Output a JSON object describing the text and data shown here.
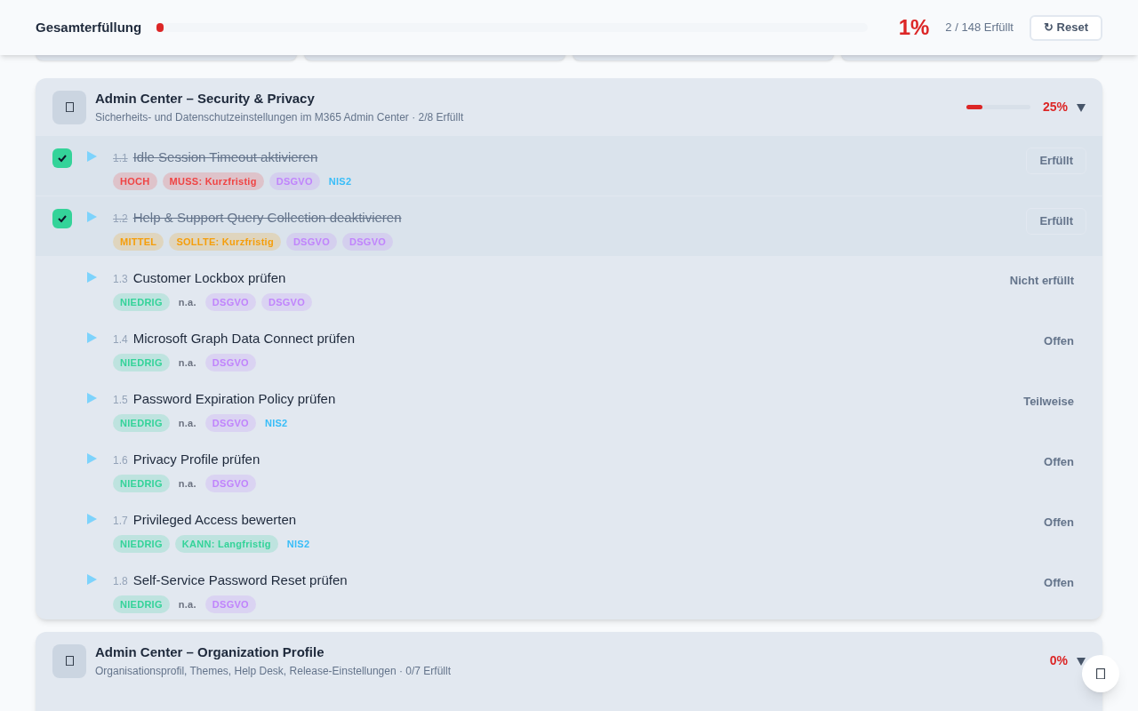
{
  "header": {
    "title": "Gesamterfüllung",
    "level": 0.01,
    "percent": "1%",
    "count": "2 / 148 Erfüllt",
    "reset_button": "↻ Reset"
  },
  "sections": [
    {
      "title": "Admin Center – Security & Privacy",
      "subtitle": "Sicherheits- und Datenschutzeinstellungen im M365 Admin Center · 2/8 Erfüllt",
      "level": 0.25,
      "percent": "25%",
      "expanded": true,
      "items": [
        {
          "number": "1.1",
          "title": "Idle Session Timeout aktivieren",
          "checked": true,
          "status": "Erfüllt",
          "tags": [
            {
              "text": "HOCH",
              "kind": "pill",
              "color": "#ef4444"
            },
            {
              "text": "MUSS: Kurzfristig",
              "kind": "pill",
              "color": "#ef4444"
            },
            {
              "text": "DSGVO",
              "kind": "pill",
              "color": "#c084fc"
            },
            {
              "text": "NIS2",
              "kind": "plain",
              "color": "#38bdf8"
            }
          ]
        },
        {
          "number": "1.2",
          "title": "Help & Support Query Collection deaktivieren",
          "checked": true,
          "status": "Erfüllt",
          "tags": [
            {
              "text": "MITTEL",
              "kind": "pill",
              "color": "#f59e0b"
            },
            {
              "text": "SOLLTE: Kurzfristig",
              "kind": "pill",
              "color": "#f59e0b"
            },
            {
              "text": "DSGVO",
              "kind": "pill",
              "color": "#c084fc"
            },
            {
              "text": "DSGVO",
              "kind": "pill",
              "color": "#c084fc"
            }
          ]
        },
        {
          "number": "1.3",
          "title": "Customer Lockbox prüfen",
          "checked": false,
          "status": "Nicht erfüllt",
          "tags": [
            {
              "text": "NIEDRIG",
              "kind": "pill",
              "color": "#34d399"
            },
            {
              "text": "n.a.",
              "kind": "plain",
              "color": "#6b7280"
            },
            {
              "text": "DSGVO",
              "kind": "pill",
              "color": "#c084fc"
            },
            {
              "text": "DSGVO",
              "kind": "pill",
              "color": "#c084fc"
            }
          ]
        },
        {
          "number": "1.4",
          "title": "Microsoft Graph Data Connect prüfen",
          "checked": false,
          "status": "Offen",
          "tags": [
            {
              "text": "NIEDRIG",
              "kind": "pill",
              "color": "#34d399"
            },
            {
              "text": "n.a.",
              "kind": "plain",
              "color": "#6b7280"
            },
            {
              "text": "DSGVO",
              "kind": "pill",
              "color": "#c084fc"
            }
          ]
        },
        {
          "number": "1.5",
          "title": "Password Expiration Policy prüfen",
          "checked": false,
          "status": "Teilweise",
          "tags": [
            {
              "text": "NIEDRIG",
              "kind": "pill",
              "color": "#34d399"
            },
            {
              "text": "n.a.",
              "kind": "plain",
              "color": "#6b7280"
            },
            {
              "text": "DSGVO",
              "kind": "pill",
              "color": "#c084fc"
            },
            {
              "text": "NIS2",
              "kind": "plain",
              "color": "#38bdf8"
            }
          ]
        },
        {
          "number": "1.6",
          "title": "Privacy Profile prüfen",
          "checked": false,
          "status": "Offen",
          "tags": [
            {
              "text": "NIEDRIG",
              "kind": "pill",
              "color": "#34d399"
            },
            {
              "text": "n.a.",
              "kind": "plain",
              "color": "#6b7280"
            },
            {
              "text": "DSGVO",
              "kind": "pill",
              "color": "#c084fc"
            }
          ]
        },
        {
          "number": "1.7",
          "title": "Privileged Access bewerten",
          "checked": false,
          "status": "Offen",
          "tags": [
            {
              "text": "NIEDRIG",
              "kind": "pill",
              "color": "#34d399"
            },
            {
              "text": "KANN: Langfristig",
              "kind": "pill",
              "color": "#34d399"
            },
            {
              "text": "NIS2",
              "kind": "plain",
              "color": "#38bdf8"
            }
          ]
        },
        {
          "number": "1.8",
          "title": "Self-Service Password Reset prüfen",
          "checked": false,
          "status": "Offen",
          "tags": [
            {
              "text": "NIEDRIG",
              "kind": "pill",
              "color": "#34d399"
            },
            {
              "text": "n.a.",
              "kind": "plain",
              "color": "#6b7280"
            },
            {
              "text": "DSGVO",
              "kind": "pill",
              "color": "#c084fc"
            }
          ]
        }
      ]
    },
    {
      "title": "Admin Center – Organization Profile",
      "subtitle": "Organisationsprofil, Themes, Help Desk, Release-Einstellungen · 0/7 Erfüllt",
      "percent": "0%",
      "expanded": true
    }
  ]
}
